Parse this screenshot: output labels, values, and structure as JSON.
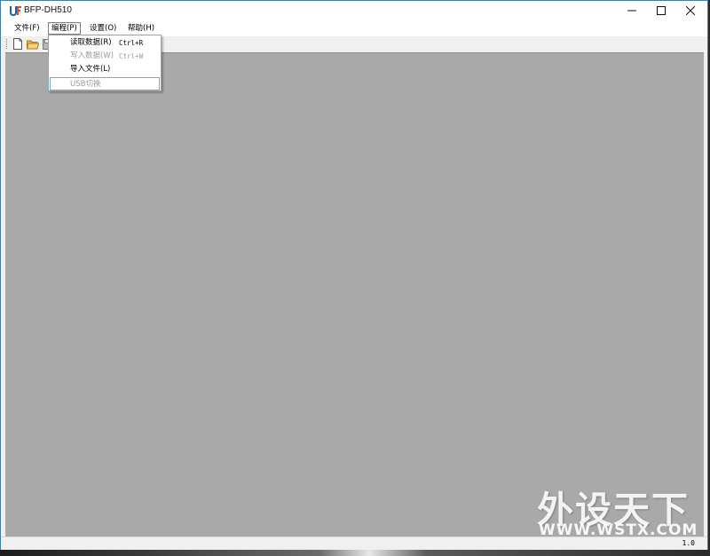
{
  "window": {
    "title": "BFP-DH510",
    "icon": "app-logo-icon",
    "controls": [
      "minimize-icon",
      "maximize-icon",
      "close-icon"
    ]
  },
  "menubar": {
    "items": [
      {
        "label": "文件(F)"
      },
      {
        "label": "编程(P)"
      },
      {
        "label": "设置(O)"
      },
      {
        "label": "帮助(H)"
      }
    ],
    "open_menu": "编程(P)"
  },
  "toolbar": {
    "buttons": [
      "new-file-icon",
      "open-folder-icon",
      "save-icon"
    ]
  },
  "dropdown": {
    "items": [
      {
        "label": "读取数据(R)",
        "shortcut": "Ctrl+R",
        "enabled": true
      },
      {
        "label": "写入数据(W)",
        "shortcut": "Ctrl+W",
        "enabled": false
      },
      {
        "label": "导入文件(L)",
        "shortcut": "",
        "enabled": true
      },
      {
        "label": "USB切换",
        "shortcut": "",
        "enabled": false
      }
    ]
  },
  "statusbar": {
    "version": "1.0"
  },
  "watermark": {
    "cn": "外设天下",
    "en": "WWW.WSTX.COM"
  },
  "colors": {
    "workspace": "#a9a9a9",
    "window_border": "#3c7fb1",
    "disabled_text": "#9a9a9a"
  }
}
